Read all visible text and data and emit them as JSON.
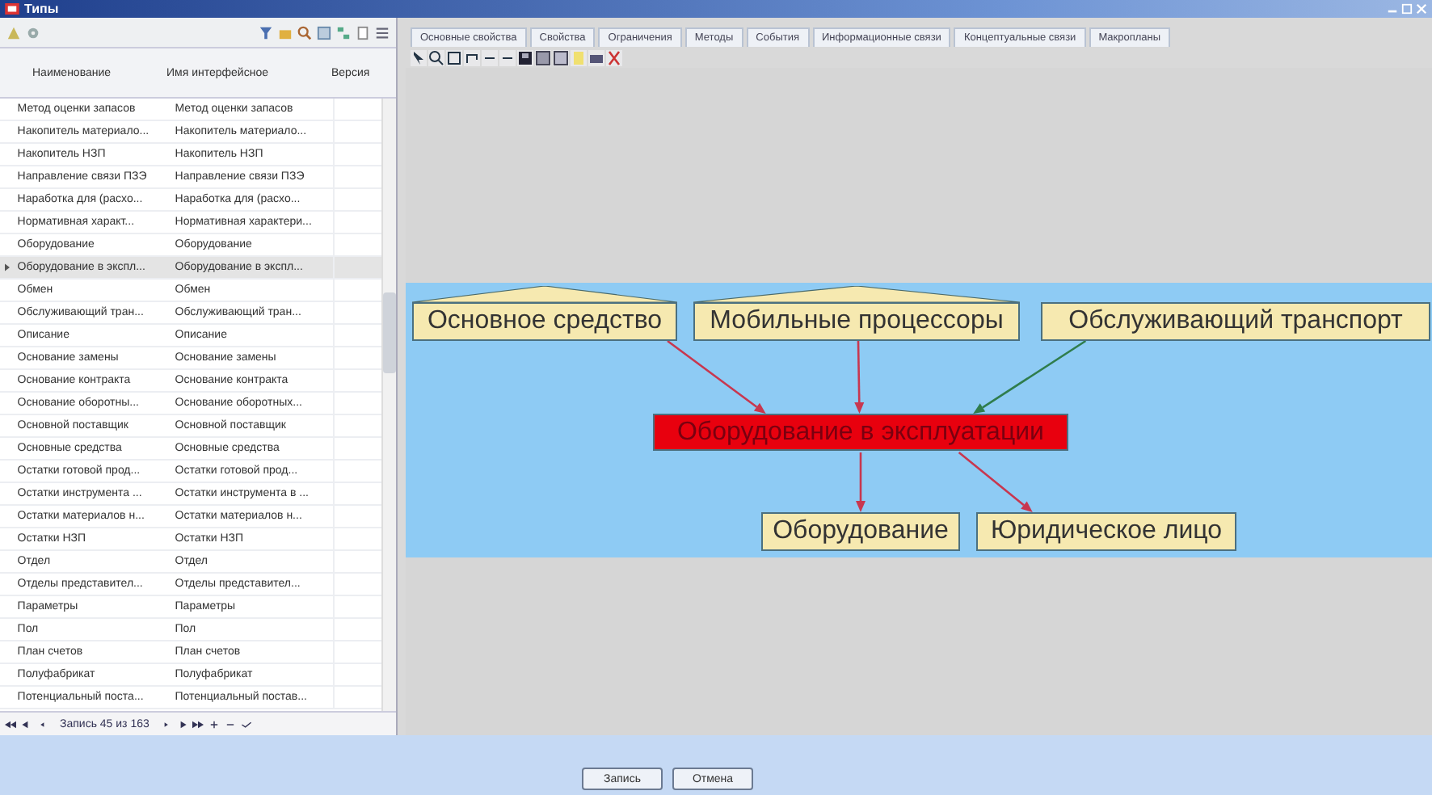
{
  "window": {
    "title": "Типы"
  },
  "list": {
    "columns": [
      "Наименование",
      "Имя интерфейсное",
      "Версия"
    ],
    "rows": [
      {
        "name": "Метод оценки запасов",
        "interface_name": "Метод оценки запасов",
        "selected": false
      },
      {
        "name": "Накопитель материало...",
        "interface_name": "Накопитель материало...",
        "selected": false
      },
      {
        "name": "Накопитель НЗП",
        "interface_name": "Накопитель НЗП",
        "selected": false
      },
      {
        "name": "Направление связи ПЗЭ",
        "interface_name": "Направление связи ПЗЭ",
        "selected": false
      },
      {
        "name": "Наработка для (расхо...",
        "interface_name": "Наработка для (расхо...",
        "selected": false
      },
      {
        "name": "Нормативная характ...",
        "interface_name": "Нормативная характери...",
        "selected": false
      },
      {
        "name": "Оборудование",
        "interface_name": "Оборудование",
        "selected": false
      },
      {
        "name": "Оборудование в экспл...",
        "interface_name": "Оборудование в экспл...",
        "selected": true
      },
      {
        "name": "Обмен",
        "interface_name": "Обмен",
        "selected": false
      },
      {
        "name": "Обслуживающий тран...",
        "interface_name": "Обслуживающий тран...",
        "selected": false
      },
      {
        "name": "Описание",
        "interface_name": "Описание",
        "selected": false
      },
      {
        "name": "Основание замены",
        "interface_name": "Основание замены",
        "selected": false
      },
      {
        "name": "Основание контракта",
        "interface_name": "Основание контракта",
        "selected": false
      },
      {
        "name": "Основание оборотны...",
        "interface_name": "Основание оборотных...",
        "selected": false
      },
      {
        "name": "Основной поставщик",
        "interface_name": "Основной поставщик",
        "selected": false
      },
      {
        "name": "Основные средства",
        "interface_name": "Основные средства",
        "selected": false
      },
      {
        "name": "Остатки готовой прод...",
        "interface_name": "Остатки готовой прод...",
        "selected": false
      },
      {
        "name": "Остатки инструмента ...",
        "interface_name": "Остатки инструмента в ...",
        "selected": false
      },
      {
        "name": "Остатки материалов н...",
        "interface_name": "Остатки материалов н...",
        "selected": false
      },
      {
        "name": "Остатки НЗП",
        "interface_name": "Остатки НЗП",
        "selected": false
      },
      {
        "name": "Отдел",
        "interface_name": "Отдел",
        "selected": false
      },
      {
        "name": "Отделы представител...",
        "interface_name": "Отделы представител...",
        "selected": false
      },
      {
        "name": "Параметры",
        "interface_name": "Параметры",
        "selected": false
      },
      {
        "name": "Пол",
        "interface_name": "Пол",
        "selected": false
      },
      {
        "name": "План счетов",
        "interface_name": "План счетов",
        "selected": false
      },
      {
        "name": "Полуфабрикат",
        "interface_name": "Полуфабрикат",
        "selected": false
      },
      {
        "name": "Потенциальный поста...",
        "interface_name": "Потенциальный постав...",
        "selected": false
      }
    ],
    "navigator": "Запись 45 из 163"
  },
  "tabs": [
    {
      "label": "Основные свойства"
    },
    {
      "label": "Свойства"
    },
    {
      "label": "Ограничения"
    },
    {
      "label": "Методы"
    },
    {
      "label": "События"
    },
    {
      "label": "Информационные связи"
    },
    {
      "label": "Концептуальные связи"
    },
    {
      "label": "Макропланы"
    }
  ],
  "diagram": {
    "nodes": [
      {
        "label": "Основное средство",
        "kind": "parent",
        "roof": true
      },
      {
        "label": "Мобильные процессоры",
        "kind": "parent",
        "roof": true
      },
      {
        "label": "Обслуживающий транспорт",
        "kind": "parent",
        "roof": false
      },
      {
        "label": "Оборудование в эксплуатации",
        "kind": "current",
        "roof": false
      },
      {
        "label": "Оборудование",
        "kind": "child",
        "roof": false
      },
      {
        "label": "Юридическое лицо",
        "kind": "child",
        "roof": false
      }
    ],
    "edges": [
      {
        "color": "#c8374f"
      },
      {
        "color": "#c8374f"
      },
      {
        "color": "#2f7d4c"
      },
      {
        "color": "#c8374f"
      },
      {
        "color": "#c8374f"
      }
    ]
  },
  "buttons": [
    "Запись",
    "Отмена"
  ]
}
